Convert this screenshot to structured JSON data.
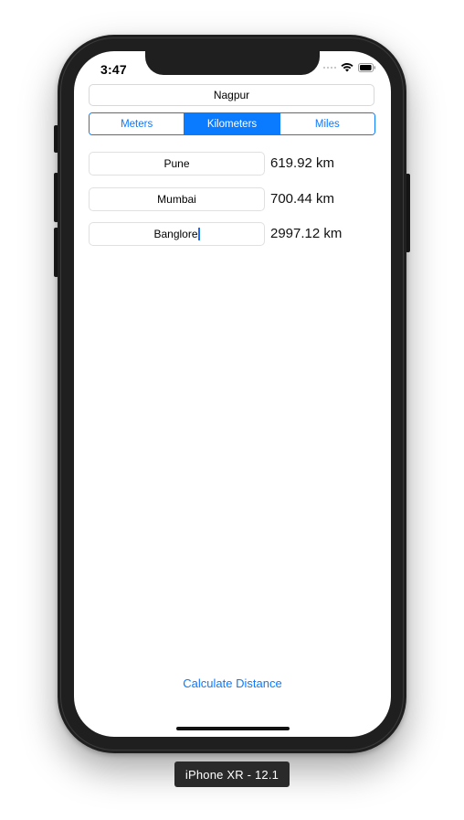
{
  "status_bar": {
    "time": "3:47"
  },
  "origin": {
    "value": "Nagpur"
  },
  "units": {
    "segments": [
      "Meters",
      "Kilometers",
      "Miles"
    ],
    "selected": "Kilometers"
  },
  "destinations": [
    {
      "city": "Pune",
      "distance": "619.92 km"
    },
    {
      "city": "Mumbai",
      "distance": "700.44 km"
    },
    {
      "city": "Banglore",
      "distance": "2997.12 km"
    }
  ],
  "actions": {
    "calculate_label": "Calculate Distance"
  },
  "simulator": {
    "device_label": "iPhone XR - 12.1"
  },
  "colors": {
    "accent": "#0a7aff",
    "phone_body": "#1f1f1f",
    "label_bg": "#2a2a2a"
  },
  "icons": {
    "signal": "signal-icon",
    "wifi": "wifi-icon",
    "battery": "battery-icon"
  }
}
